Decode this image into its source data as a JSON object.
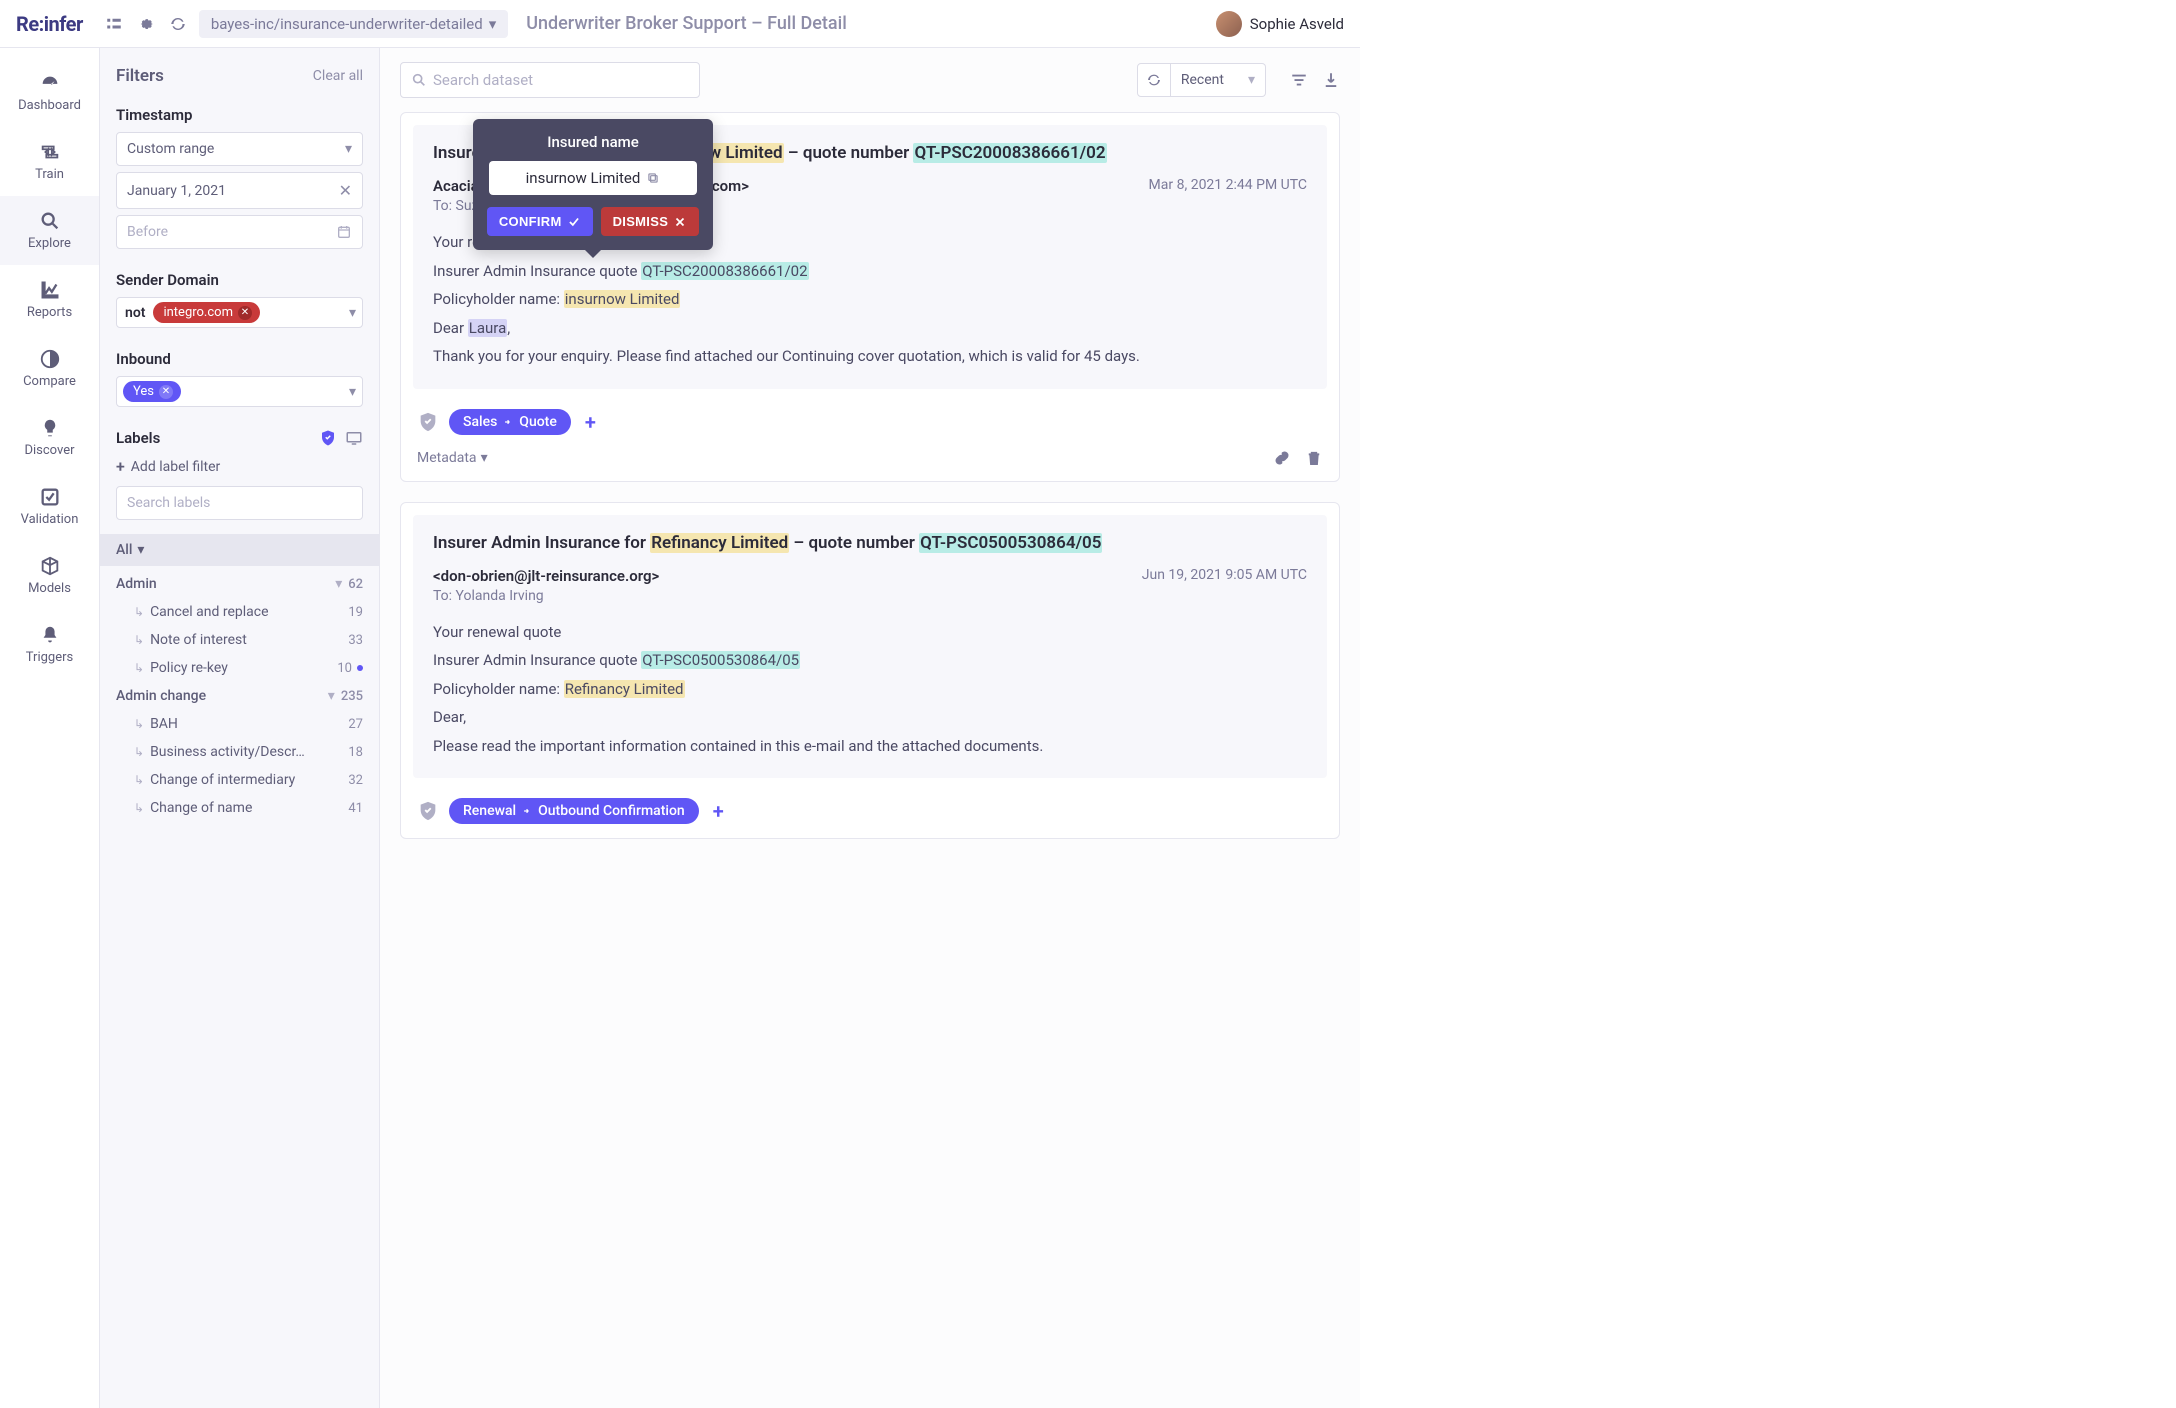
{
  "topbar": {
    "logo": "Re:infer",
    "dataset": "bayes-inc/insurance-underwriter-detailed",
    "title": "Underwriter Broker Support – Full Detail",
    "user_name": "Sophie Asveld"
  },
  "nav": {
    "items": [
      {
        "label": "Dashboard"
      },
      {
        "label": "Train"
      },
      {
        "label": "Explore"
      },
      {
        "label": "Reports"
      },
      {
        "label": "Compare"
      },
      {
        "label": "Discover"
      },
      {
        "label": "Validation"
      },
      {
        "label": "Models"
      },
      {
        "label": "Triggers"
      }
    ]
  },
  "filters": {
    "header": "Filters",
    "clear_all": "Clear all",
    "timestamp_label": "Timestamp",
    "timestamp_range": "Custom range",
    "timestamp_from": "January 1, 2021",
    "timestamp_to_placeholder": "Before",
    "sender_domain_label": "Sender Domain",
    "sender_not": "not",
    "sender_tag": "integro.com",
    "inbound_label": "Inbound",
    "inbound_tag": "Yes",
    "labels_header": "Labels",
    "add_label": "Add label filter",
    "search_labels_placeholder": "Search labels",
    "all_row": "All",
    "tree": [
      {
        "name": "Admin",
        "count": "62",
        "parent": true
      },
      {
        "name": "Cancel and replace",
        "count": "19"
      },
      {
        "name": "Note of interest",
        "count": "33"
      },
      {
        "name": "Policy re-key",
        "count": "10",
        "dot": true
      },
      {
        "name": "Admin change",
        "count": "235",
        "parent": true
      },
      {
        "name": "BAH",
        "count": "27"
      },
      {
        "name": "Business activity/Descr…",
        "count": "18"
      },
      {
        "name": "Change of intermediary",
        "count": "32"
      },
      {
        "name": "Change of name",
        "count": "41"
      }
    ]
  },
  "main": {
    "search_placeholder": "Search dataset",
    "sort": "Recent",
    "metadata_label": "Metadata"
  },
  "popover": {
    "title": "Insured name",
    "value": "insurnow Limited",
    "confirm": "CONFIRM",
    "dismiss": "DISMISS"
  },
  "cards": [
    {
      "subject_prefix": "Insurer Admin Insurance for ",
      "subject_hl1": "insurnow Limited",
      "subject_mid": " – quote number ",
      "subject_hl2": "QT-PSC20008386661/02",
      "from": "Acacia Barnes <leia.gonzales@jlt-london.com>",
      "to": "To: Suzanne Salazar",
      "timestamp": "Mar 8, 2021 2:44 PM UTC",
      "line1": "Your renewal quote",
      "line2_pre": "Insurer Admin Insurance quote ",
      "line2_hl": "QT-PSC20008386661/02",
      "line3_pre": "Policyholder name: ",
      "line3_hl": "insurnow Limited",
      "line4_pre": "Dear ",
      "line4_hl": "Laura",
      "line4_post": ",",
      "line5": "Thank you for your enquiry. Please find attached our Continuing cover quotation, which is valid for 45 days.",
      "label1": "Sales",
      "label2": "Quote"
    },
    {
      "subject_prefix": "Insurer Admin Insurance for ",
      "subject_hl1": "Refinancy Limited",
      "subject_mid": " – quote number ",
      "subject_hl2": "QT-PSC0500530864/05",
      "from": "<don-obrien@jlt-reinsurance.org>",
      "to": "To: Yolanda Irving",
      "timestamp": "Jun 19, 2021 9:05 AM UTC",
      "line1": "Your renewal quote",
      "line2_pre": "Insurer Admin Insurance quote ",
      "line2_hl": "QT-PSC0500530864/05",
      "line3_pre": "Policyholder name: ",
      "line3_hl": "Refinancy Limited",
      "line4_pre": "Dear",
      "line4_post": ",",
      "line5": "Please read the important information contained in this e-mail and the attached documents.",
      "label1": "Renewal",
      "label2": "Outbound Confirmation"
    }
  ]
}
